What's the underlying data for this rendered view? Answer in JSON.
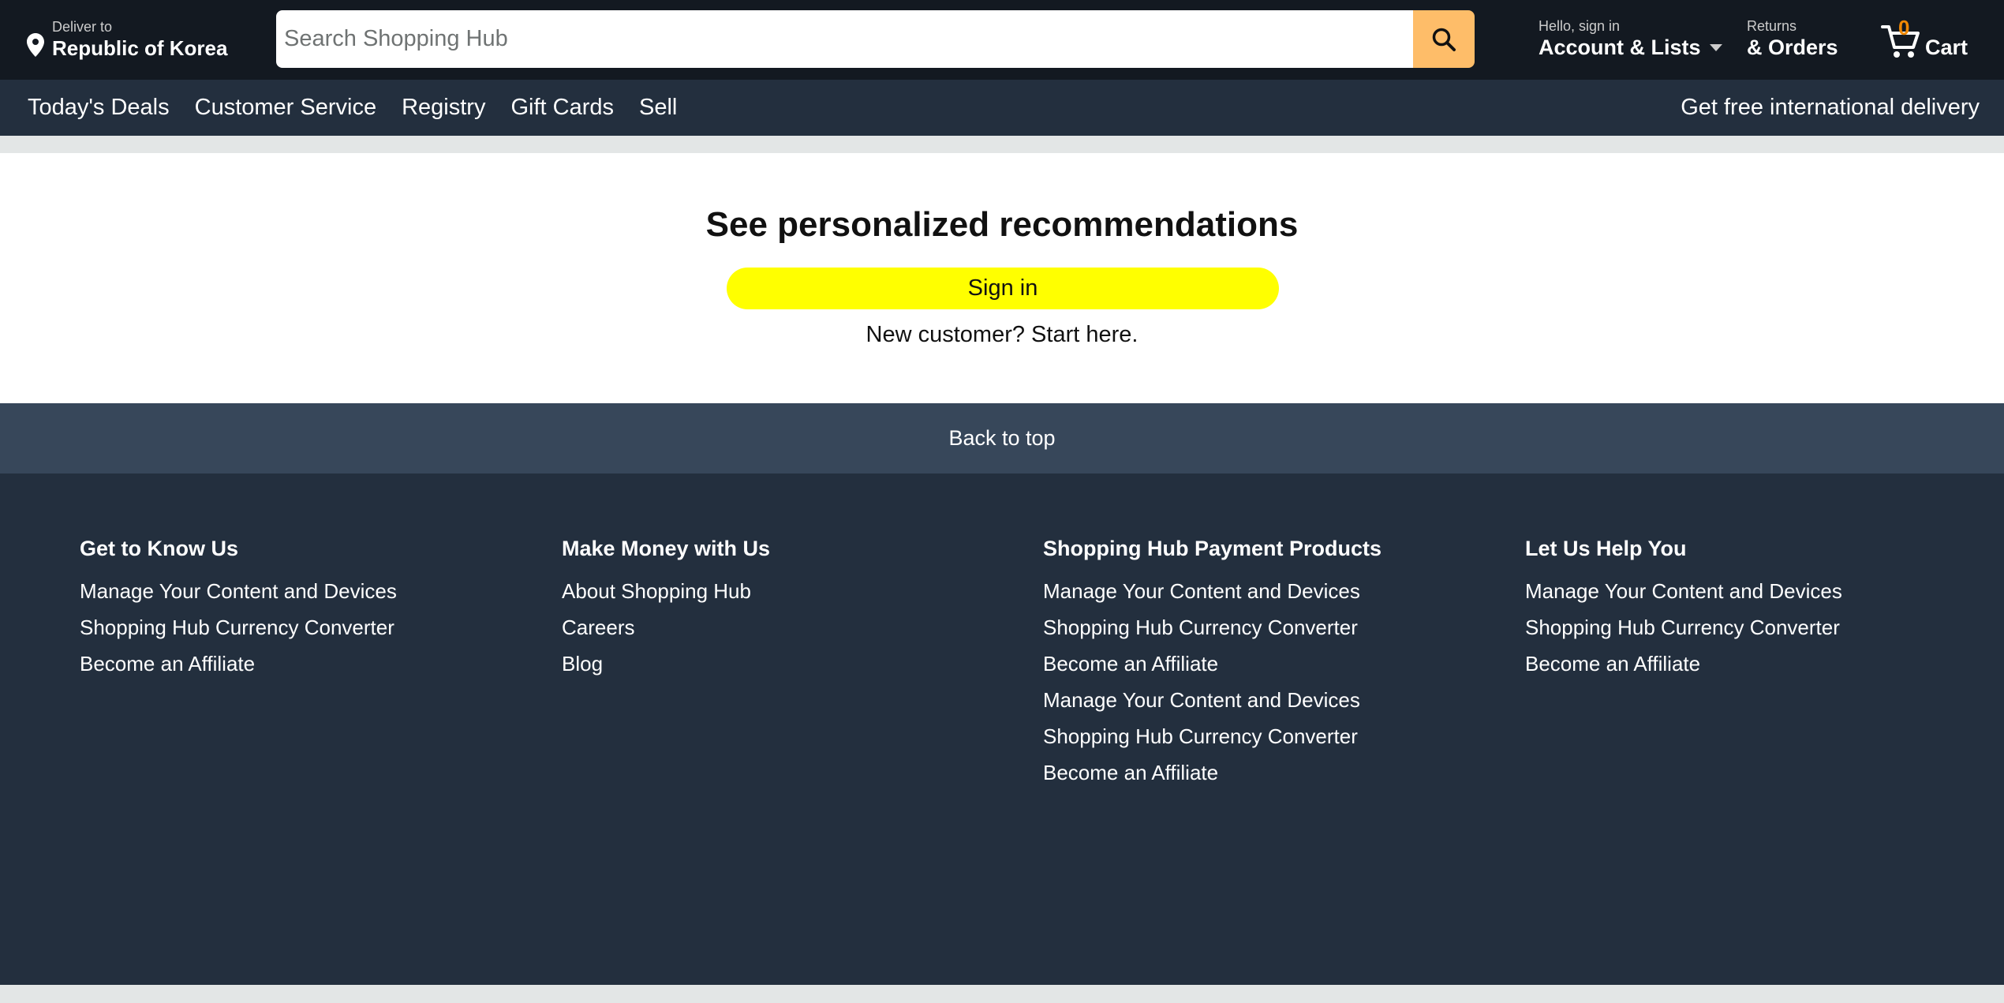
{
  "header": {
    "deliver_label": "Deliver to",
    "deliver_location": "Republic of Korea",
    "search_placeholder": "Search Shopping Hub",
    "account_greeting": "Hello, sign in",
    "account_label": "Account & Lists",
    "returns_label": "Returns",
    "orders_label": "& Orders",
    "cart_count": "0",
    "cart_label": "Cart"
  },
  "nav": {
    "links": [
      "Today's Deals",
      "Customer Service",
      "Registry",
      "Gift Cards",
      "Sell"
    ],
    "promo": "Get free international delivery"
  },
  "signin": {
    "title": "See personalized recommendations",
    "button": "Sign in",
    "new_customer": "New customer? Start here."
  },
  "back_to_top": "Back to top",
  "footer": {
    "columns": [
      {
        "heading": "Get to Know Us",
        "links": [
          "Manage Your Content and Devices",
          "Shopping Hub Currency Converter",
          "Become an Affiliate"
        ]
      },
      {
        "heading": "Make Money with Us",
        "links": [
          "About Shopping Hub",
          "Careers",
          "Blog"
        ]
      },
      {
        "heading": "Shopping Hub Payment Products",
        "links": [
          "Manage Your Content and Devices",
          "Shopping Hub Currency Converter",
          "Become an Affiliate",
          "Manage Your Content and Devices",
          "Shopping Hub Currency Converter",
          "Become an Affiliate"
        ]
      },
      {
        "heading": "Let Us Help You",
        "links": [
          "Manage Your Content and Devices",
          "Shopping Hub Currency Converter",
          "Become an Affiliate"
        ]
      }
    ]
  },
  "colors": {
    "header_bg": "#131921",
    "nav_bg": "#232f3e",
    "search_button": "#febd69",
    "signin_button": "#ffff00",
    "back_to_top_bg": "#37475a",
    "cart_count": "#f08804"
  }
}
